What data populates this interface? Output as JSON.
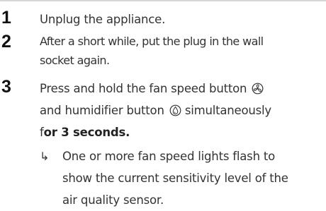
{
  "steps": [
    {
      "number": "1",
      "text": "Unplug the appliance."
    },
    {
      "number": "2",
      "line1": "After a short while, put the plug in the wall",
      "line2": "socket again."
    },
    {
      "number": "3",
      "line1": "Press and hold the fan speed button",
      "line2": "and humidifier button",
      "line2_end": "simultaneously",
      "line3_prefix": "f",
      "line3_bold": "or 3 seconds.",
      "icons": [
        "fan-speed-icon",
        "humidifier-icon"
      ]
    }
  ],
  "result": {
    "arrow": "↳",
    "line1": "One or more fan speed lights flash to",
    "line2": "show the current sensitivity level of the",
    "line3": "air quality sensor."
  }
}
